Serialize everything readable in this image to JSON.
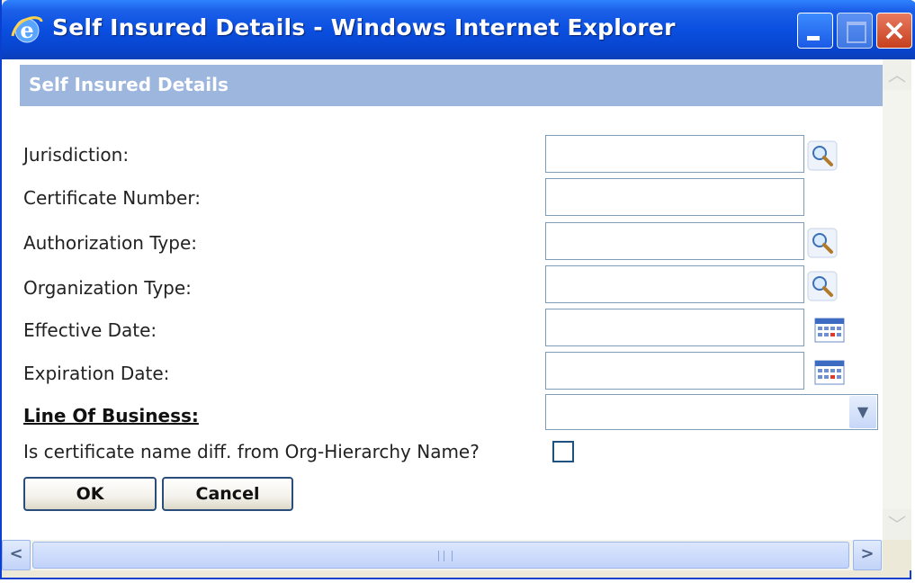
{
  "window": {
    "title": "Self Insured Details - Windows Internet Explorer"
  },
  "header": {
    "title": "Self Insured Details"
  },
  "form": {
    "jurisdiction_label": "Jurisdiction:",
    "jurisdiction_value": "",
    "certificate_number_label": "Certificate Number:",
    "certificate_number_value": "",
    "authorization_type_label": "Authorization Type:",
    "authorization_type_value": "",
    "organization_type_label": "Organization Type:",
    "organization_type_value": "",
    "effective_date_label": "Effective Date:",
    "effective_date_value": "",
    "expiration_date_label": "Expiration Date:",
    "expiration_date_value": "",
    "line_of_business_label": "Line Of Business:",
    "line_of_business_value": "",
    "cert_name_diff_label": "Is certificate name diff. from Org-Hierarchy Name?",
    "cert_name_diff_checked": false
  },
  "buttons": {
    "ok_label": "OK",
    "cancel_label": "Cancel"
  },
  "icons": {
    "lookup": "magnifier-icon",
    "calendar": "calendar-icon"
  },
  "colors": {
    "titlebar": "#0a4fe0",
    "header_band": "#9db6dd",
    "field_border": "#7f9db9"
  }
}
